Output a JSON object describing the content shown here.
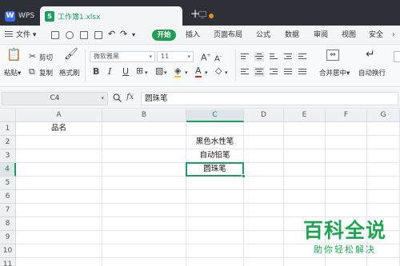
{
  "titlebar": {
    "app_tab": "WPS",
    "doc_tab": "工作簿1.xlsx",
    "new_tab_symbol": "+"
  },
  "menubar": {
    "file": "文件",
    "tabs": [
      "开始",
      "插入",
      "页面布局",
      "公式",
      "数据",
      "审阅",
      "视图",
      "安全"
    ]
  },
  "ribbon": {
    "paste": "粘贴",
    "cut": "剪切",
    "copy": "复制",
    "format_painter": "格式刷",
    "font_name": "微软雅黑",
    "font_size": "11",
    "merge_center": "合并居中",
    "auto_wrap": "自动换行",
    "bold": "B",
    "italic": "I",
    "underline": "U",
    "grow_font": "A",
    "shrink_font": "A"
  },
  "formula_bar": {
    "name_box": "C4",
    "fx": "fx",
    "content": "圆珠笔"
  },
  "sheet": {
    "columns": [
      "A",
      "B",
      "C",
      "D",
      "E",
      "F",
      "G"
    ],
    "rows": [
      "1",
      "2",
      "3",
      "4",
      "5",
      "6",
      "7",
      "8",
      "9",
      "10",
      "11"
    ],
    "active_cell": "C4",
    "cells": {
      "A1": "品名",
      "C2": "黑色水性笔",
      "C3": "自动铅笔",
      "C4": "圆珠笔"
    }
  },
  "watermark": {
    "title": "百科全说",
    "subtitle": "助你轻松解决"
  },
  "colors": {
    "accent": "#1e9d63",
    "titlebar": "#2d3036",
    "watermark": "#20a454"
  }
}
